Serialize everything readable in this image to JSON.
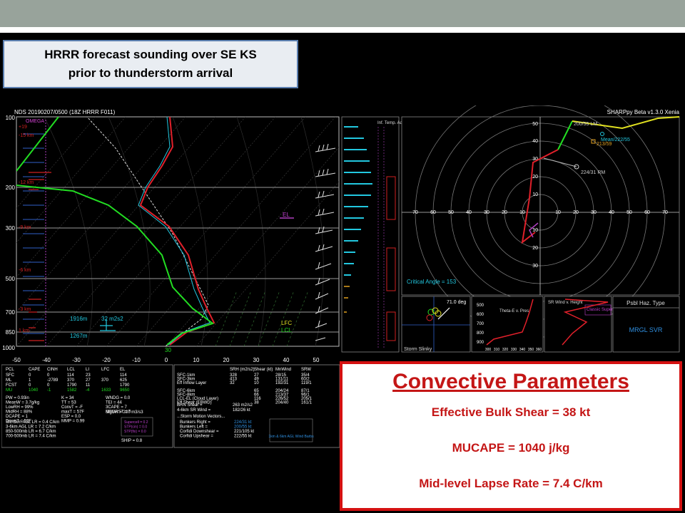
{
  "slide": {
    "title_line1": "HRRR forecast sounding over SE KS",
    "title_line2": "prior to thunderstorm arrival"
  },
  "sounding": {
    "header_left": "NDS  20190207/0500  (18Z  HRRR  F011)",
    "header_right": "SHARPpy Beta v1.3.0 Xenia",
    "pressure_labels": [
      "100",
      "200",
      "300",
      "500",
      "700",
      "850",
      "1000"
    ],
    "temp_labels": [
      "-50",
      "-40",
      "-30",
      "-20",
      "-10",
      "0",
      "10",
      "20",
      "30",
      "40",
      "50"
    ],
    "omega_label": "OMEGA",
    "left_annotations": [
      "+19",
      "-15 km",
      "-12 km",
      "-9 km",
      "-6 km",
      "-3 km",
      "1 km"
    ],
    "el_label": "EL",
    "lfc_label": "LFC",
    "lcl_label": "LCL",
    "annot_1916m": "1916m",
    "annot_1267m": "1267m",
    "annot_srh": "32 m2s2",
    "surface_temp": "30"
  },
  "panels": {
    "inf_temp_label": "Inf. Temp. Adv. (C/hr)",
    "hodograph": {
      "critical_angle": "Critical Angle = 153",
      "rings": [
        "70",
        "60",
        "50",
        "40",
        "30",
        "20",
        "10",
        "10",
        "20",
        "30",
        "40",
        "50",
        "60",
        "70"
      ],
      "y_ticks": [
        "50",
        "40",
        "30",
        "20",
        "10",
        "10",
        "20",
        "30"
      ],
      "lm": "200/55 LM",
      "mean": "Mean/222/55",
      "shear": "213/59",
      "rm": "224/31 RM"
    },
    "slinky": {
      "angle": "71.0 deg",
      "label": "Storm Slinky"
    },
    "theta": {
      "title": "Theta-E v. Pres",
      "p_ticks": [
        "500",
        "600",
        "700",
        "800",
        "900"
      ],
      "x_ticks": [
        "300",
        "310",
        "320",
        "330",
        "340",
        "350",
        "360"
      ]
    },
    "srwind": {
      "title": "SR Wind v. Height",
      "note": "Classic Supercell"
    },
    "hazard": {
      "title": "Psbl Haz. Type",
      "value": "MRGL SVR"
    }
  },
  "table": {
    "parcel_header": [
      "PCL",
      "CAPE",
      "CINH",
      "LCL",
      "LI",
      "LFC",
      "EL"
    ],
    "parcel_rows": [
      [
        "SFC",
        "0",
        "0",
        "114",
        "23",
        "",
        "114"
      ],
      [
        "ML",
        "1",
        "-2789",
        "370",
        "27",
        "370",
        "625"
      ],
      [
        "FCST",
        "0",
        "0",
        "1790",
        "11",
        "",
        "1790"
      ],
      [
        "MU",
        "1040",
        "-1",
        "1582",
        "-4",
        "1633",
        "9650"
      ]
    ],
    "misc_left": [
      "PW = 0.93in",
      "MeanW = 3.7g/kg",
      "LowRH = 99%",
      "MidRH = 88%",
      "DCAPE = 1",
      "DownT = 52F"
    ],
    "misc_mid": [
      "K = 34",
      "TT = 53",
      "ConvT = -F",
      "maxT = 57F",
      "ESP = 0.0",
      "MMP = 0.99"
    ],
    "misc_right": [
      "WNDG = 0.0",
      "TEI = 44",
      "3CAPE = 7",
      "MBURST = 0",
      "",
      ""
    ],
    "sig_svr": "SigSvr = 237 m3/s3",
    "lapse": [
      "Sfc-3km AGL LR = 0.4 C/km",
      "3-6km AGL LR = 7.2 C/km",
      "850-500mb LR = 6.7 C/km",
      "700-500mb LR = 7.4 C/km"
    ],
    "supercell": [
      "Supercell = 0.2",
      "STP(cin) = 0.0",
      "STP(fix) = 0.0"
    ],
    "ship": "SHIP = 0.8",
    "kin_header": [
      "SRH (m2/s2)",
      "Shear (kt)",
      "MnWind",
      "SRW"
    ],
    "kin_rows": [
      [
        "SFC-1km",
        "328",
        "27",
        "28/15",
        "35/4"
      ],
      [
        "SFC-3km",
        "413",
        "49",
        "131/11",
        "60/2"
      ],
      [
        "Eff Inflow Layer",
        "32",
        "10",
        "192/31",
        "119/1"
      ],
      [
        "",
        "",
        " ",
        "",
        ""
      ],
      [
        "SFC-6km",
        "",
        "65",
        "204/24",
        "87/1"
      ],
      [
        "SFC-8km",
        "",
        "66",
        "213/37",
        "96/1"
      ],
      [
        "LCL-EL (Cloud Layer)",
        "",
        "116",
        "226/52",
        "205/1"
      ],
      [
        "Eff Shear (EBWD)",
        "",
        "38",
        "204/40",
        "161/1"
      ]
    ],
    "brn_shear": "BRN Shear =",
    "brn_val": "263 m2/s2",
    "srwind": "4-6km SR Wind =",
    "srwind_val": "182/26 kt",
    "motion_title": "...Storm Motion Vectors...",
    "motion": [
      [
        "Bunkers Right =",
        "224/31 kt"
      ],
      [
        "Bunkers Left =",
        "200/55 kt"
      ],
      [
        "Corfidi Downshear =",
        "221/105 kt"
      ],
      [
        "Corfidi Upshear =",
        "222/55 kt"
      ]
    ],
    "wind_barb_note": "1km & 6km AGL Wind Barbs"
  },
  "convective": {
    "title": "Convective Parameters",
    "line1": "Effective Bulk Shear = 38 kt",
    "line2": "MUCAPE  = 1040 j/kg",
    "line3": "Mid-level Lapse Rate = 7.4 C/km"
  },
  "colors": {
    "temp_profile": "#e0202a",
    "dewpoint": "#22dd22",
    "wetbulb": "#22c8e0",
    "parcel": "#dddddd",
    "accent_red": "#c41616",
    "title_border": "#5b7fb0"
  }
}
